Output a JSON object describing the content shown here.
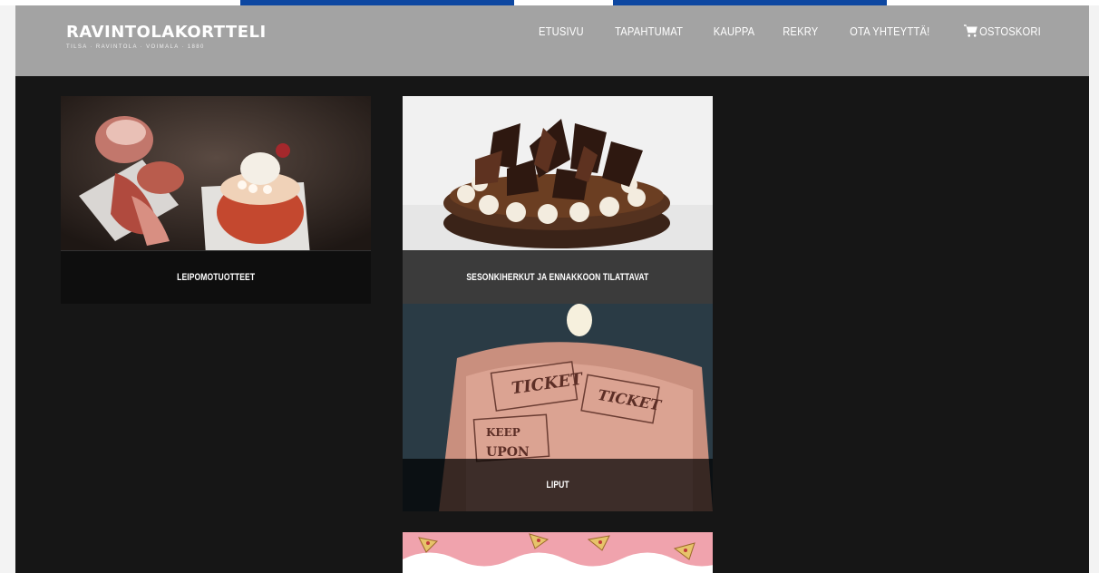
{
  "site": {
    "logo_main": "RAVINTOLAKORTTELI",
    "logo_tagline": "TILSA · RAVINTOLA · VOIMALA · 1880"
  },
  "nav": {
    "items": [
      {
        "label": "Etusivu"
      },
      {
        "label": "Tapahtumat"
      },
      {
        "label": "Kauppa"
      },
      {
        "label": "Rekry"
      },
      {
        "label": "Ota yhteyttä!"
      }
    ],
    "cart_label": "Ostoskori"
  },
  "categories": [
    {
      "label": "Leipomotuotteet",
      "image": "pastries-cupcake"
    },
    {
      "label": "Sesonkiherkut ja ennakkoon tilattavat",
      "image": "chocolate-cake"
    },
    {
      "label": "Liput",
      "image": "ticket-roll"
    },
    {
      "label": "",
      "image": "pizza-pattern"
    }
  ],
  "colors": {
    "navbar": "#a3a3a3",
    "background": "#161616",
    "top_accent": "#0d47a1"
  }
}
